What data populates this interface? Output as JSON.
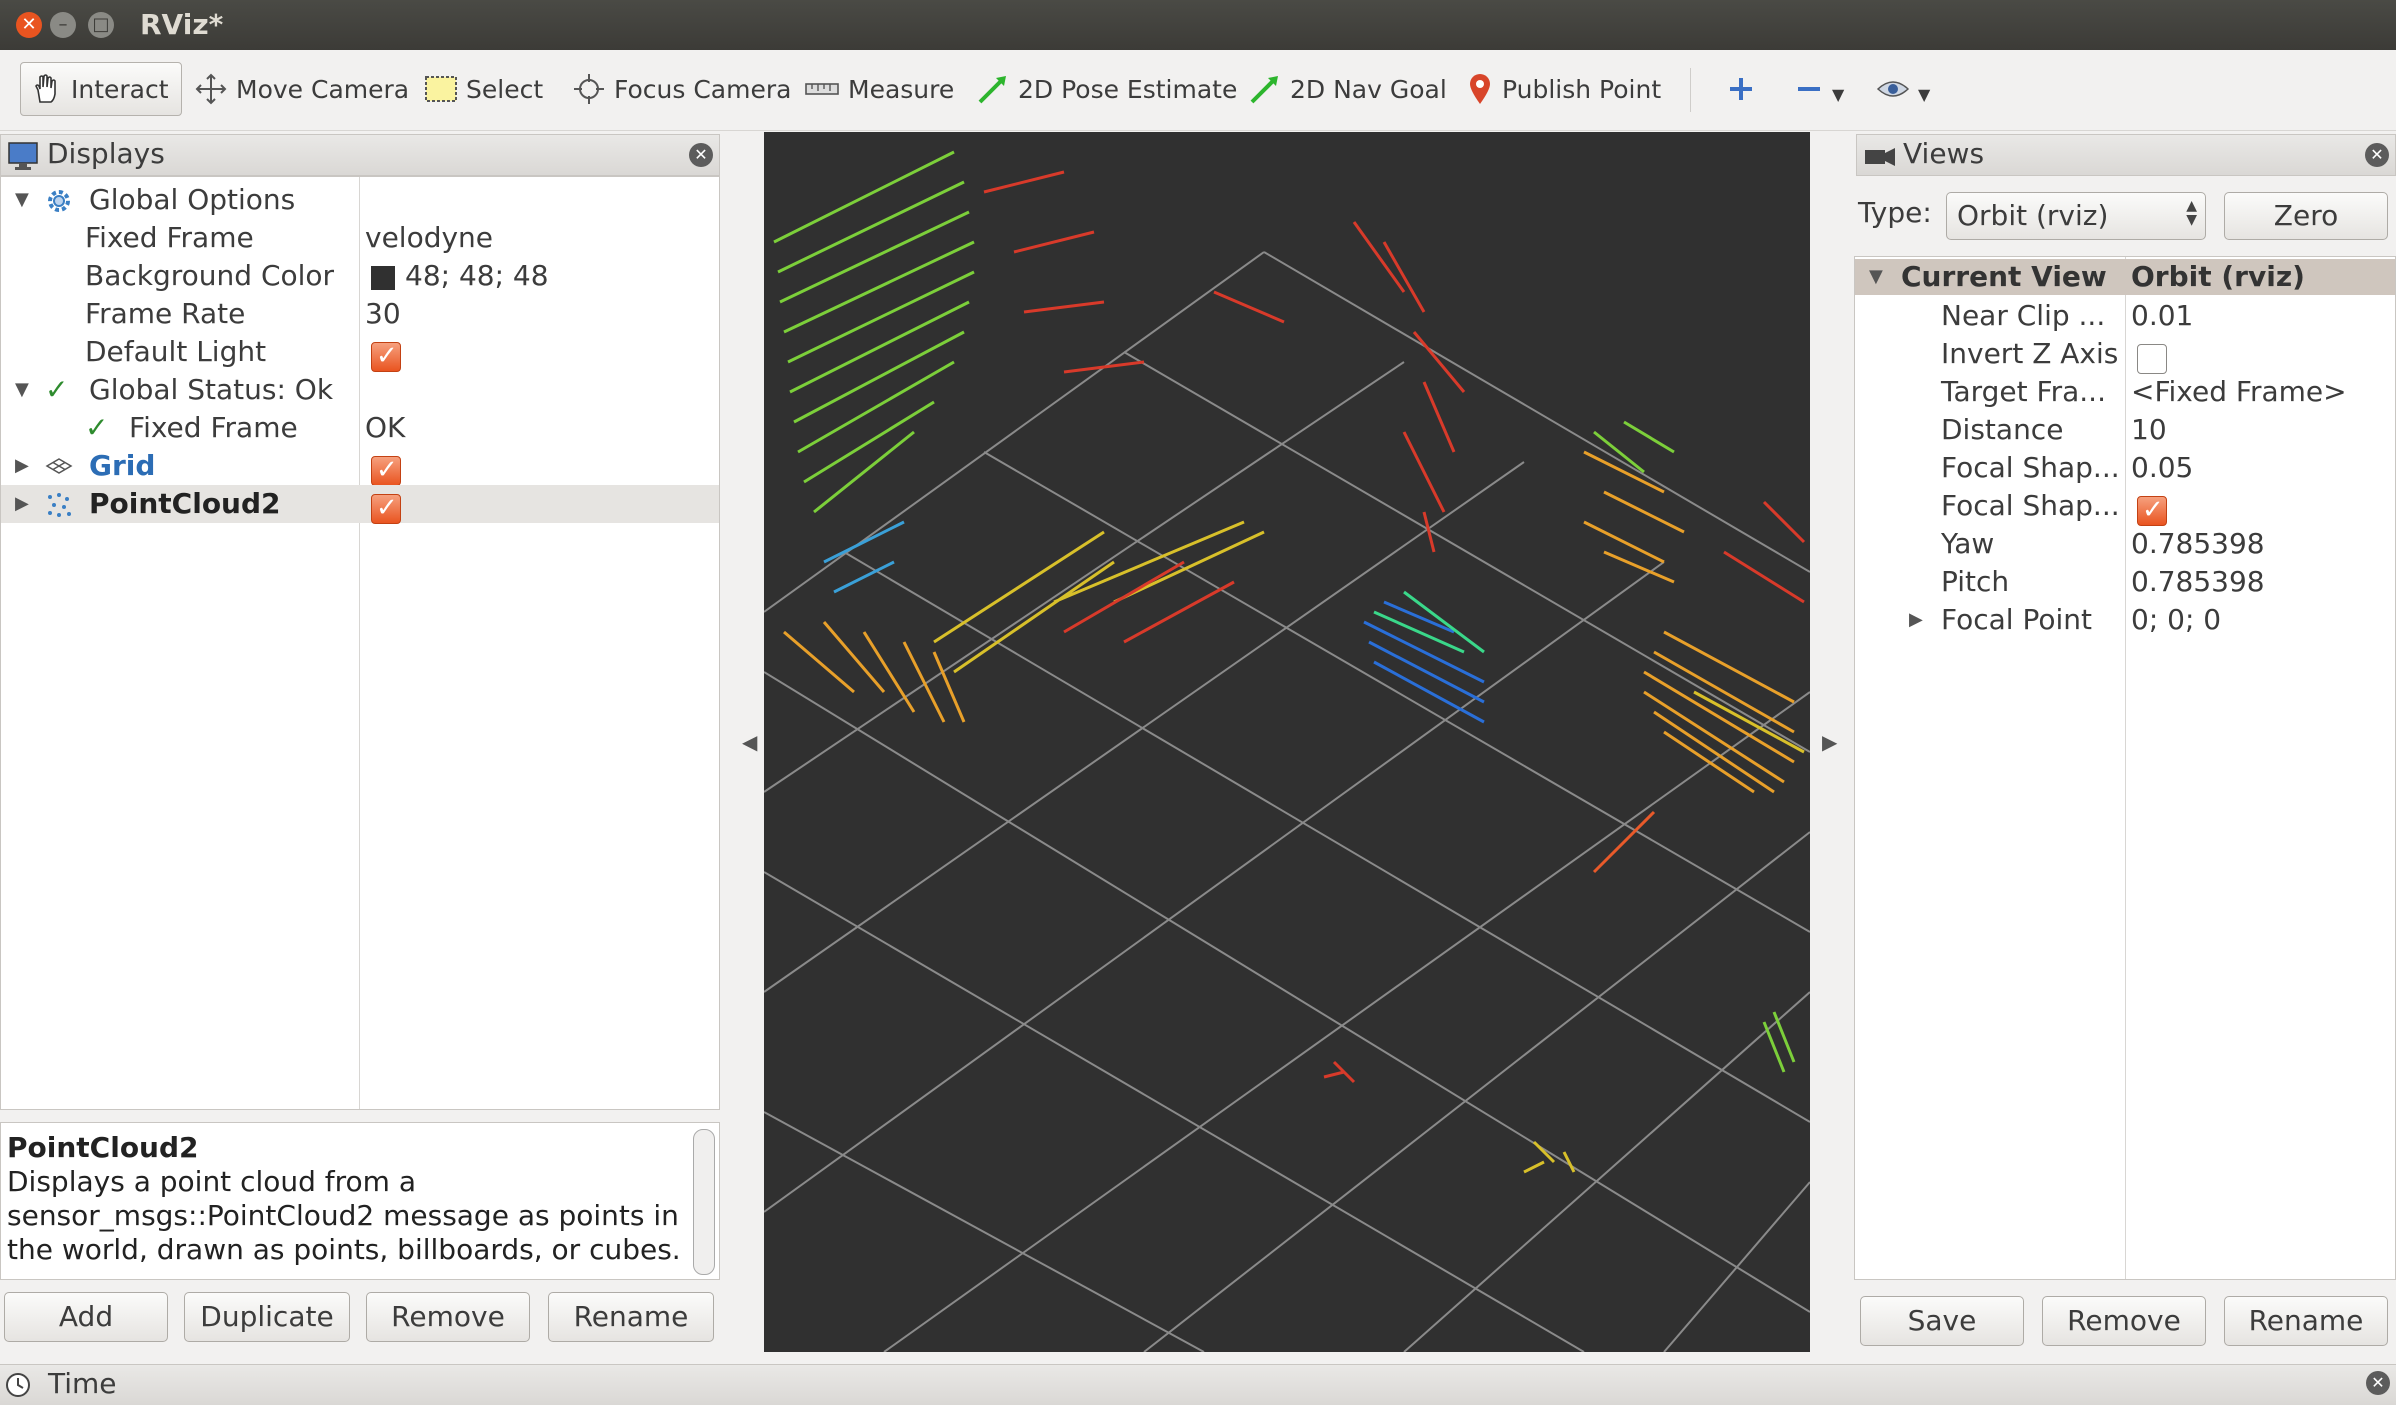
{
  "window": {
    "title": "RViz*"
  },
  "toolbar": {
    "tools": [
      {
        "label": "Interact",
        "icon": "hand-icon",
        "active": true
      },
      {
        "label": "Move Camera",
        "icon": "move-camera-icon"
      },
      {
        "label": "Select",
        "icon": "select-icon"
      },
      {
        "label": "Focus Camera",
        "icon": "focus-camera-icon"
      },
      {
        "label": "Measure",
        "icon": "ruler-icon"
      },
      {
        "label": "2D Pose Estimate",
        "icon": "green-arrow-icon"
      },
      {
        "label": "2D Nav Goal",
        "icon": "green-arrow-icon"
      },
      {
        "label": "Publish Point",
        "icon": "map-pin-icon"
      }
    ]
  },
  "displays": {
    "title": "Displays",
    "rows": [
      {
        "name": "Global Options",
        "value": ""
      },
      {
        "name": "Fixed Frame",
        "value": "velodyne"
      },
      {
        "name": "Background Color",
        "value": "48; 48; 48"
      },
      {
        "name": "Frame Rate",
        "value": "30"
      },
      {
        "name": "Default Light",
        "value": ""
      },
      {
        "name": "Global Status: Ok",
        "value": ""
      },
      {
        "name": "Fixed Frame",
        "value": "OK"
      },
      {
        "name": "Grid",
        "value": ""
      },
      {
        "name": "PointCloud2",
        "value": ""
      }
    ],
    "description": {
      "title": "PointCloud2",
      "text": "Displays a point cloud from a sensor_msgs::PointCloud2 message as points in the world, drawn as points, billboards, or cubes."
    },
    "buttons": {
      "add": "Add",
      "duplicate": "Duplicate",
      "remove": "Remove",
      "rename": "Rename"
    }
  },
  "views": {
    "title": "Views",
    "type_label": "Type:",
    "type_value": "Orbit (rviz)",
    "zero_label": "Zero",
    "header": {
      "name": "Current View",
      "value": "Orbit (rviz)"
    },
    "rows": [
      {
        "name": "Near Clip ...",
        "value": "0.01"
      },
      {
        "name": "Invert Z Axis",
        "value": ""
      },
      {
        "name": "Target Fra...",
        "value": "<Fixed Frame>"
      },
      {
        "name": "Distance",
        "value": "10"
      },
      {
        "name": "Focal Shap...",
        "value": "0.05"
      },
      {
        "name": "Focal Shap...",
        "value": ""
      },
      {
        "name": "Yaw",
        "value": "0.785398"
      },
      {
        "name": "Pitch",
        "value": "0.785398"
      },
      {
        "name": "Focal Point",
        "value": "0; 0; 0"
      }
    ],
    "buttons": {
      "save": "Save",
      "remove": "Remove",
      "rename": "Rename"
    }
  },
  "time_panel": {
    "title": "Time"
  },
  "colors": {
    "viewport_bg": "#303030",
    "grid": "#a0a0a0",
    "accent": "#e95420"
  }
}
